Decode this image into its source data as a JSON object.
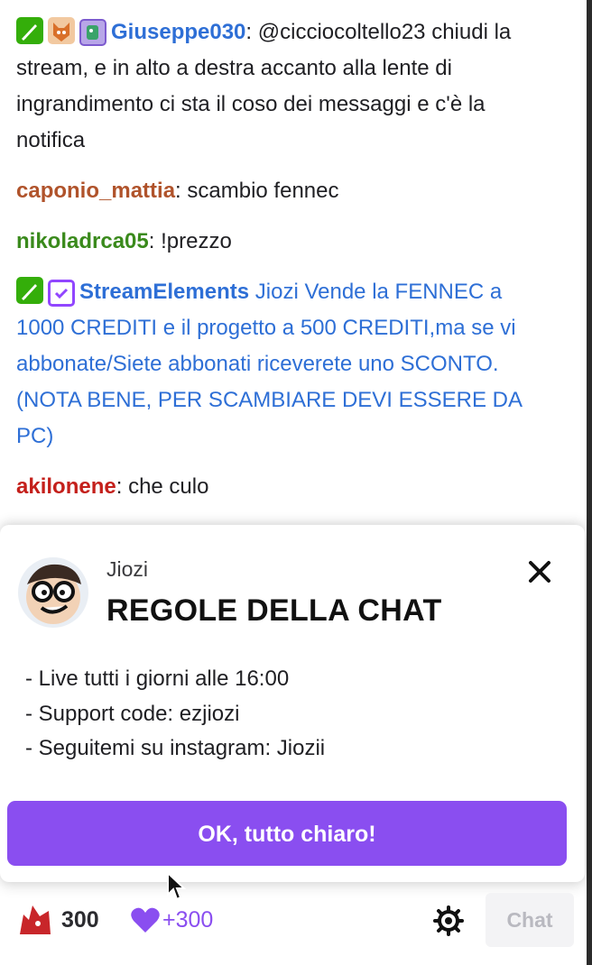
{
  "chat": {
    "messages": [
      {
        "badges": [
          "sword-badge",
          "fox-badge",
          "subscriber-badge"
        ],
        "username": "Giuseppe030",
        "separator": ": ",
        "text": "@cicciocoltello23 chiudi la stream, e in alto a destra accanto alla lente di ingrandimento ci sta il coso dei messaggi e c'è la notifica"
      },
      {
        "username": "caponio_mattia",
        "separator": ": ",
        "text": "scambio fennec"
      },
      {
        "username": "nikoladrca05",
        "separator": ": ",
        "text": "!prezzo"
      },
      {
        "badges": [
          "sword-badge",
          "verified-badge"
        ],
        "username": "StreamElements",
        "separator": " ",
        "text": "Jiozi Vende la FENNEC a 1000 CREDITI e il progetto a 500 CREDITI,ma se vi abbonate/Siete abbonati riceverete uno SCONTO. (NOTA BENE, PER SCAMBIARE DEVI ESSERE DA PC)"
      },
      {
        "username": "akilonene",
        "separator": ": ",
        "text": "che culo"
      }
    ],
    "colors": {
      "Giuseppe030": "#2e6fd6",
      "caponio_mattia": "#b0532b",
      "nikoladrca05": "#3a8a1c",
      "StreamElements": "#2e6fd6",
      "akilonene": "#c4201b"
    }
  },
  "rules_modal": {
    "streamer_name": "Jiozi",
    "title": "REGOLE DELLA CHAT",
    "rules": [
      "- Live tutti i giorni alle 16:00",
      "- Support code: ezjiozi",
      "- Seguitemi su instagram: Jiozii"
    ],
    "confirm_label": "OK, tutto chiaro!",
    "close_icon": "close-icon",
    "accent_color": "#8a4ef0"
  },
  "bottom_bar": {
    "points": "300",
    "bonus": "+300",
    "chat_button_label": "Chat",
    "points_icon": "channel-points-icon",
    "bonus_icon": "heart-icon",
    "settings_icon": "gear-icon"
  }
}
